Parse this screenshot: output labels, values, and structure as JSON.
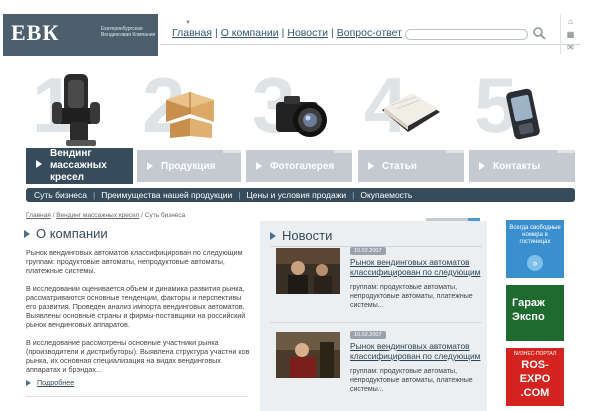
{
  "logo": {
    "mark": "ЕВК",
    "text": "Екатеринбургская Вендинговая Компания"
  },
  "topnav": {
    "items": [
      {
        "label": "Главная"
      },
      {
        "label": "О компании"
      },
      {
        "label": "Новости"
      },
      {
        "label": "Вопрос-ответ"
      }
    ],
    "separator": "|"
  },
  "search": {
    "value": "",
    "placeholder": ""
  },
  "categories": [
    {
      "number": "1",
      "label": "Вендинг массажных кресел",
      "active": true
    },
    {
      "number": "2",
      "label": "Продукция",
      "active": false
    },
    {
      "number": "3",
      "label": "Фотогалерея",
      "active": false
    },
    {
      "number": "4",
      "label": "Статьи",
      "active": false
    },
    {
      "number": "5",
      "label": "Контакты",
      "active": false
    }
  ],
  "subnav": {
    "items": [
      {
        "label": "Суть бизнеса"
      },
      {
        "label": "Преимущества нашей продукции"
      },
      {
        "label": "Цены и условия продажи"
      },
      {
        "label": "Окупаемость"
      }
    ],
    "separator": "|"
  },
  "breadcrumb": {
    "items": [
      {
        "label": "Главная"
      },
      {
        "label": "Вендинг массажных кресел"
      },
      {
        "label": "Суть бизнеса"
      }
    ],
    "separator": "/"
  },
  "about": {
    "title": "О компании",
    "paragraphs": [
      "Рынок вендинговых автоматов классифицирован по следующим группам: продуктовые автоматы, непродуктовые автоматы, платежные системы.",
      "В исследовании оценивается объем и динамика развития рынка, рассматриваются основные тенденции, факторы и перспективы его развития. Проведен анализ импорта вендинговых автоматов. Выявлены основные страны и фирмы-поставщики на российский рынок вендинговых аппаратов.",
      "В исследование рассмотрены основные участники рынка (производители и дистрибуторы). Выявлена структура участни ков рынка, их основная специализация на видах вендинговых аппаратах и брэндах..."
    ],
    "more_label": "Подробнее"
  },
  "news": {
    "title": "Новости",
    "items": [
      {
        "date": "10.02.2007",
        "headline": "Рынок вендинговых автоматов классифицирован по следующим",
        "text": "группам: продуктовые автоматы, непродуктовые автоматы, платежные системы..."
      },
      {
        "date": "10.02.2007",
        "headline": "Рынок вендинговых автоматов классифицирован по следующим",
        "text": "группам: продуктовые автоматы, непродуктовые автоматы, платежные системы..."
      }
    ]
  },
  "banners": {
    "hotel": "Всегда свободные номера в гостиницах",
    "hotel_button": "»",
    "garage_line1": "Гараж",
    "garage_line2": "Экспо",
    "expo_top": "БИЗНЕС-ПОРТАЛ",
    "expo_line1": "ROS-",
    "expo_line2": "EXPO",
    "expo_line3": ".COM"
  },
  "colors": {
    "primary": "#364c5c",
    "tab_inactive": "#c4cad0",
    "accent_blue": "#3a8fcf",
    "garage_green": "#1f6a2e",
    "expo_red": "#d5231f"
  }
}
